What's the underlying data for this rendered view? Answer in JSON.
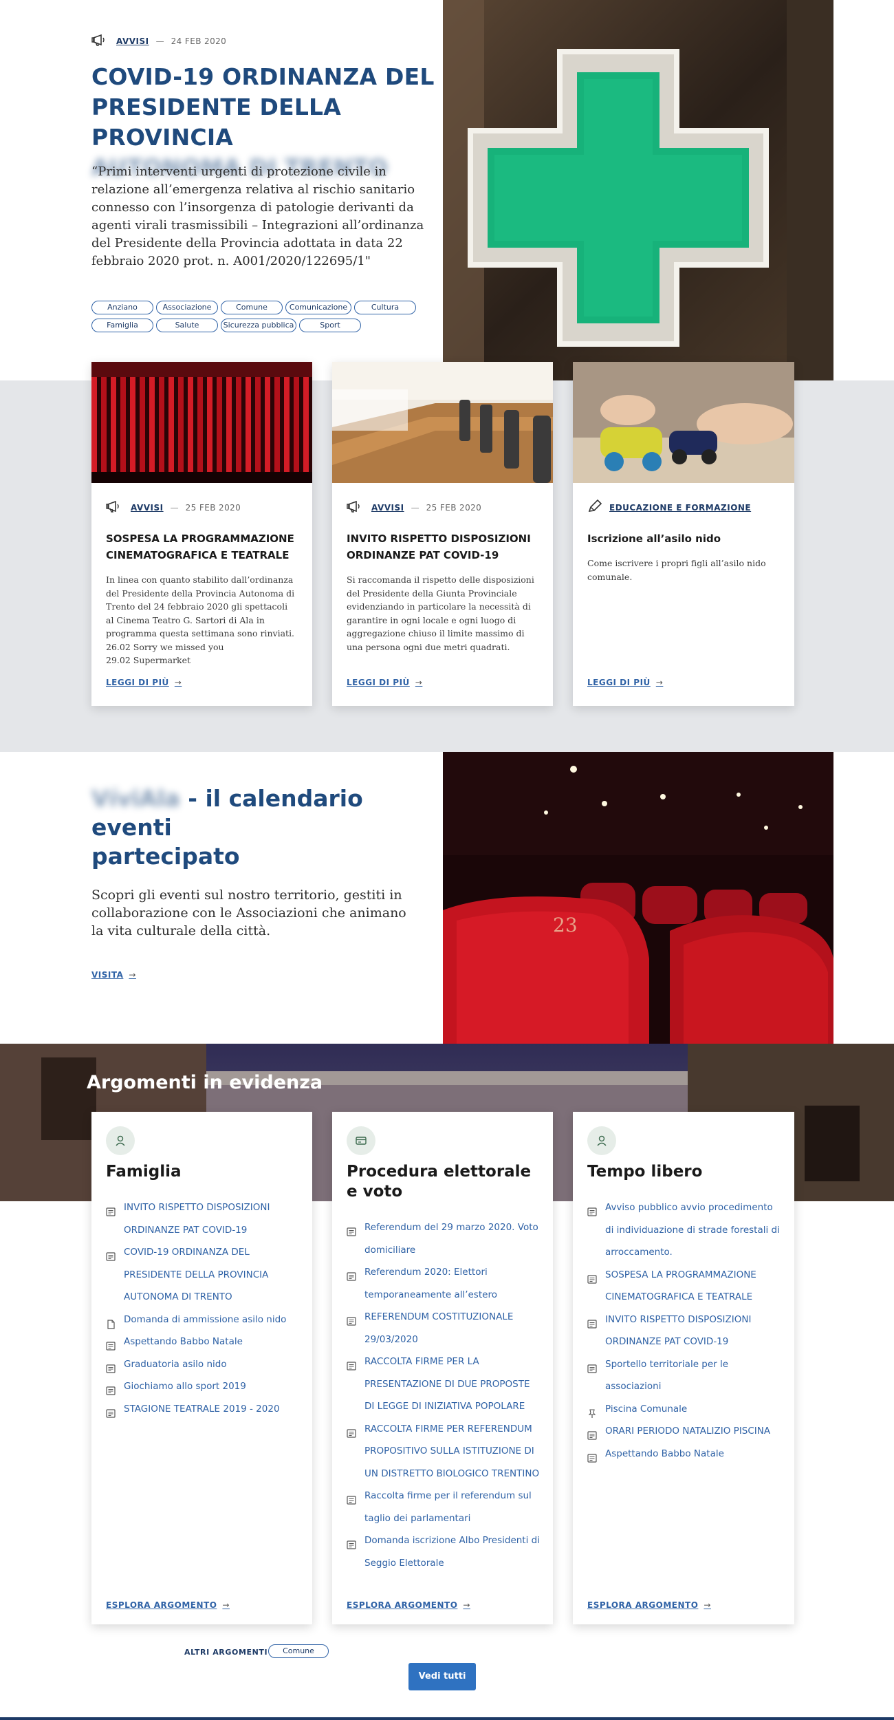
{
  "hero": {
    "category": "AVVISI",
    "date": "24 FEB 2020",
    "title_line1": "COVID-19 ORDINANZA DEL",
    "title_line2": "PRESIDENTE DELLA PROVINCIA",
    "title_line3": "AUTONOMA DI TRENTO",
    "quote": "“Primi interventi urgenti di protezione civile in relazione all’emergenza relativa al rischio sanitario connesso con l’insorgenza di patologie derivanti da agenti virali trasmissibili – Integrazioni all’ordinanza del Presidente della Provincia adottata in data 22 febbraio 2020 prot. n. A001/2020/122695/1\"",
    "tags": [
      "Anziano",
      "Associazione",
      "Comune",
      "Comunicazione",
      "Cultura",
      "Famiglia",
      "Salute",
      "Sicurezza pubblica",
      "Sport"
    ]
  },
  "cards": [
    {
      "category": "AVVISI",
      "date": "25 FEB 2020",
      "title": "SOSPESA LA PROGRAMMAZIONE CINEMATOGRAFICA E TEATRALE",
      "text": "In linea con quanto stabilito dall’ordinanza del Presidente della Provincia Autonoma di Trento del 24 febbraio 2020 gli spettacoli al Cinema Teatro G. Sartori di Ala in programma questa settimana sono rinviati.",
      "text_line2": "26.02 Sorry we missed you",
      "text_line3": "29.02 Supermarket",
      "read_more": "LEGGI DI PIÙ"
    },
    {
      "category": "AVVISI",
      "date": "25 FEB 2020",
      "title": "INVITO RISPETTO DISPOSIZIONI ORDINANZE PAT COVID-19",
      "text": "Si raccomanda il rispetto delle disposizioni del Presidente della Giunta Provinciale evidenziando in particolare la necessità di garantire in ogni locale e ogni luogo di aggregazione chiuso il limite massimo di una persona ogni due metri quadrati.",
      "read_more": "LEGGI DI PIÙ"
    },
    {
      "category": "EDUCAZIONE E FORMAZIONE",
      "title": "Iscrizione all’asilo nido",
      "text": "Come iscrivere i propri figli all’asilo nido comunale.",
      "read_more": "LEGGI DI PIÙ"
    }
  ],
  "viviala": {
    "title_blurred": "VíviAla",
    "title_rest": " - il calendario eventi",
    "title_line2": "partecipato",
    "text": "Scopri gli eventi sul nostro territorio, gestiti in collaborazione con le Associazioni che animano la vita culturale della città.",
    "link": "VISITA",
    "seat_number": "23"
  },
  "argomenti": {
    "heading": "Argomenti in evidenza",
    "topics": [
      {
        "title": "Famiglia",
        "icon": "person-icon",
        "items": [
          {
            "text": "INVITO RISPETTO DISPOSIZIONI ORDINANZE PAT COVID-19",
            "icon": "news-icon"
          },
          {
            "text": "COVID-19 ORDINANZA DEL PRESIDENTE DELLA PROVINCIA AUTONOMA DI TRENTO",
            "icon": "news-icon"
          },
          {
            "text": "Domanda di ammissione asilo nido",
            "icon": "document-icon"
          },
          {
            "text": "Aspettando Babbo Natale",
            "icon": "news-icon"
          },
          {
            "text": "Graduatoria asilo nido",
            "icon": "news-icon"
          },
          {
            "text": "Giochiamo allo sport 2019",
            "icon": "news-icon"
          },
          {
            "text": "STAGIONE TEATRALE 2019 - 2020",
            "icon": "news-icon"
          }
        ],
        "explore": "ESPLORA ARGOMENTO"
      },
      {
        "title": "Procedura elettorale e voto",
        "icon": "card-icon",
        "items": [
          {
            "text": "Referendum del 29 marzo 2020. Voto domiciliare",
            "icon": "news-icon"
          },
          {
            "text": "Referendum 2020: Elettori temporaneamente all’estero",
            "icon": "news-icon"
          },
          {
            "text": "REFERENDUM COSTITUZIONALE 29/03/2020",
            "icon": "news-icon"
          },
          {
            "text": "RACCOLTA FIRME PER LA PRESENTAZIONE DI DUE PROPOSTE DI LEGGE DI INIZIATIVA POPOLARE",
            "icon": "news-icon"
          },
          {
            "text": "RACCOLTA FIRME PER REFERENDUM PROPOSITIVO SULLA ISTITUZIONE DI UN DISTRETTO BIOLOGICO TRENTINO",
            "icon": "news-icon"
          },
          {
            "text": "Raccolta firme per il referendum sul taglio dei parlamentari",
            "icon": "news-icon"
          },
          {
            "text": "Domanda iscrizione Albo Presidenti di Seggio Elettorale",
            "icon": "news-icon"
          }
        ],
        "explore": "ESPLORA ARGOMENTO"
      },
      {
        "title": "Tempo libero",
        "icon": "person-icon",
        "items": [
          {
            "text": "Avviso pubblico avvio procedimento di individuazione di strade forestali di arroccamento.",
            "icon": "news-icon"
          },
          {
            "text": "SOSPESA LA PROGRAMMAZIONE CINEMATOGRAFICA E TEATRALE",
            "icon": "news-icon"
          },
          {
            "text": "INVITO RISPETTO DISPOSIZIONI ORDINANZE PAT COVID-19",
            "icon": "news-icon"
          },
          {
            "text": "Sportello territoriale per le associazioni",
            "icon": "news-icon"
          },
          {
            "text": "Piscina Comunale",
            "icon": "pin-icon"
          },
          {
            "text": "ORARI PERIODO NATALIZIO PISCINA",
            "icon": "news-icon"
          },
          {
            "text": "Aspettando Babbo Natale",
            "icon": "news-icon"
          }
        ],
        "explore": "ESPLORA ARGOMENTO"
      }
    ],
    "altri_label": "ALTRI ARGOMENTI",
    "altri_tag": "Comune",
    "see_all": "Vedi tutti"
  },
  "colors": {
    "primary": "#2f72c1",
    "title_blue": "#1f4a7d",
    "link_blue": "#2f62a6",
    "band_grey": "#e4e6e9",
    "pharmacy_green": "#12b57a"
  }
}
